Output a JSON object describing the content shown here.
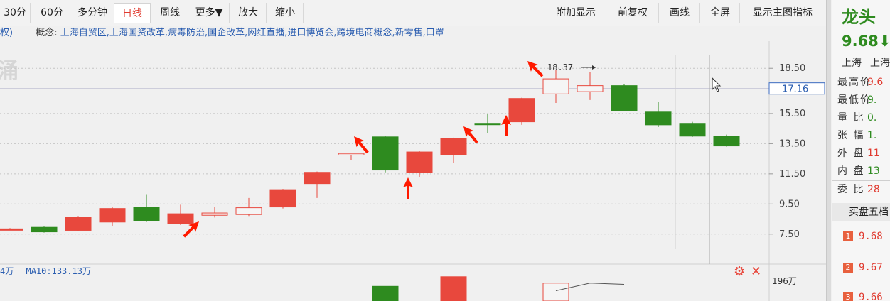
{
  "toolbar": {
    "tabs": [
      {
        "label": "30分",
        "active": false
      },
      {
        "label": "60分",
        "active": false
      },
      {
        "label": "多分钟",
        "active": false
      },
      {
        "label": "日线",
        "active": true
      },
      {
        "label": "周线",
        "active": false
      },
      {
        "label": "更多▼",
        "active": false
      },
      {
        "label": "放大",
        "active": false
      },
      {
        "label": "缩小",
        "active": false
      }
    ],
    "right_buttons": [
      "附加显示",
      "前复权",
      "画线",
      "全屏",
      "显示主图指标"
    ]
  },
  "concept": {
    "prefix": "权)",
    "label": "概念:",
    "value": "上海自贸区,上海国资改革,病毒防治,国企改革,网红直播,进口博览会,跨境电商概念,新零售,口罩"
  },
  "chart_data": {
    "type": "candlestick",
    "watermark": "涌",
    "y_ticks": [
      "18.50",
      "15.50",
      "13.50",
      "11.50",
      "9.50",
      "7.50"
    ],
    "ylim": [
      6.5,
      19.5
    ],
    "current_price_label": "17.16",
    "current_price": 17.16,
    "high_annotation": "18.37",
    "high_value": 18.37,
    "candles": [
      {
        "o": 7.85,
        "c": 7.85,
        "h": 7.9,
        "l": 7.8
      },
      {
        "o": 7.95,
        "c": 7.65,
        "h": 8.0,
        "l": 7.6
      },
      {
        "o": 7.75,
        "c": 8.6,
        "h": 8.7,
        "l": 7.7
      },
      {
        "o": 8.3,
        "c": 9.2,
        "h": 9.3,
        "l": 8.05
      },
      {
        "o": 9.3,
        "c": 8.4,
        "h": 10.15,
        "l": 8.3
      },
      {
        "o": 8.2,
        "c": 8.85,
        "h": 9.45,
        "l": 8.1
      },
      {
        "o": 8.75,
        "c": 8.9,
        "h": 9.3,
        "l": 8.6
      },
      {
        "o": 8.8,
        "c": 9.25,
        "h": 9.9,
        "l": 8.7
      },
      {
        "o": 9.3,
        "c": 10.45,
        "h": 10.5,
        "l": 9.2
      },
      {
        "o": 10.85,
        "c": 11.6,
        "h": 11.65,
        "l": 9.9
      },
      {
        "o": 12.75,
        "c": 12.85,
        "h": 12.9,
        "l": 12.4
      },
      {
        "o": 13.95,
        "c": 11.75,
        "h": 14.0,
        "l": 11.6
      },
      {
        "o": 11.6,
        "c": 12.95,
        "h": 13.0,
        "l": 11.3
      },
      {
        "o": 12.75,
        "c": 13.85,
        "h": 13.9,
        "l": 12.2
      },
      {
        "o": 14.85,
        "c": 14.8,
        "h": 15.45,
        "l": 14.2
      },
      {
        "o": 14.95,
        "c": 16.5,
        "h": 16.55,
        "l": 14.75
      },
      {
        "o": 16.8,
        "c": 17.8,
        "h": 18.37,
        "l": 16.2
      },
      {
        "o": 16.95,
        "c": 17.35,
        "h": 18.25,
        "l": 16.4
      },
      {
        "o": 17.35,
        "c": 15.7,
        "h": 17.45,
        "l": 15.65
      },
      {
        "o": 15.6,
        "c": 14.75,
        "h": 16.3,
        "l": 14.6
      },
      {
        "o": 14.85,
        "c": 14.0,
        "h": 14.95,
        "l": 13.95
      },
      {
        "o": 14.0,
        "c": 13.35,
        "h": 14.1,
        "l": 13.3
      }
    ],
    "volume_axis_label": "196万",
    "volume_bars": [
      {
        "index": 11,
        "value": 1.15
      },
      {
        "index": 13,
        "value": 1.9
      },
      {
        "index": 16,
        "value": 1.4
      }
    ],
    "volume_ma_points": [
      {
        "index": 16,
        "value": 0.75
      },
      {
        "index": 17,
        "value": 1.35
      },
      {
        "index": 18,
        "value": 1.25
      }
    ]
  },
  "volume_legend": {
    "prefix": "4万",
    "ma10": "MA10:133.13万"
  },
  "panel": {
    "name": "龙头",
    "price": "9.68⬇",
    "markets": [
      "上海",
      "上海"
    ],
    "stats": [
      {
        "key": "最高价",
        "value": "9.6",
        "color": "red"
      },
      {
        "key": "最低价",
        "value": "9.",
        "color": "green"
      },
      {
        "key": "量 比",
        "value": "0.",
        "color": "green"
      },
      {
        "key": "张 幅",
        "value": "1.",
        "color": "green"
      },
      {
        "key": "外 盘",
        "value": "11",
        "color": "red"
      },
      {
        "key": "内 盘",
        "value": "13",
        "color": "green"
      },
      {
        "key": "委 比",
        "value": "28",
        "color": "red"
      }
    ],
    "book_title": "买盘五档",
    "book": [
      {
        "idx": "1",
        "price": "9.68"
      },
      {
        "idx": "2",
        "price": "9.67"
      },
      {
        "idx": "3",
        "price": "9.66"
      }
    ]
  },
  "colors": {
    "up": "#e8483d",
    "down": "#2e8b1f",
    "accent": "#2a5db0",
    "arrow": "#ff1a00"
  }
}
